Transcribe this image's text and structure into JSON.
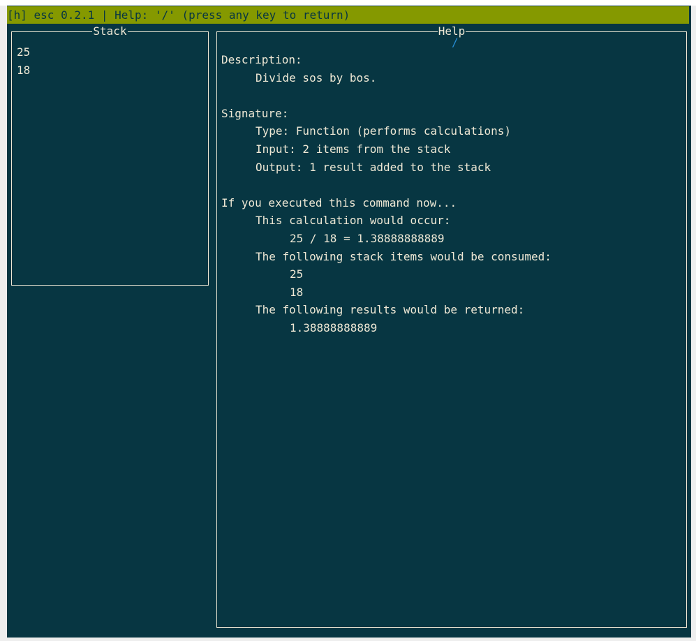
{
  "header": {
    "text": "[h] esc 0.2.1 | Help: '/' (press any key to return)"
  },
  "stack_panel": {
    "title": "Stack",
    "items": [
      "25",
      "18"
    ]
  },
  "help_panel": {
    "title": "Help",
    "operator": "/",
    "description_heading": "Description:",
    "description": "Divide sos by bos.",
    "signature_heading": "Signature:",
    "signature": {
      "type": "Type: Function (performs calculations)",
      "input": "Input: 2 items from the stack",
      "output": "Output: 1 result added to the stack"
    },
    "execution_heading": "If you executed this command now...",
    "calc_heading": "This calculation would occur:",
    "calc": "25 / 18 = 1.38888888889",
    "consumed_heading": "The following stack items would be consumed:",
    "consumed": [
      "25",
      "18"
    ],
    "returned_heading": "The following results would be returned:",
    "returned": [
      "1.38888888889"
    ]
  },
  "colors": {
    "background": "#073642",
    "title_bar": "#859900",
    "text": "#eee8d5",
    "operator": "#268bd2"
  }
}
